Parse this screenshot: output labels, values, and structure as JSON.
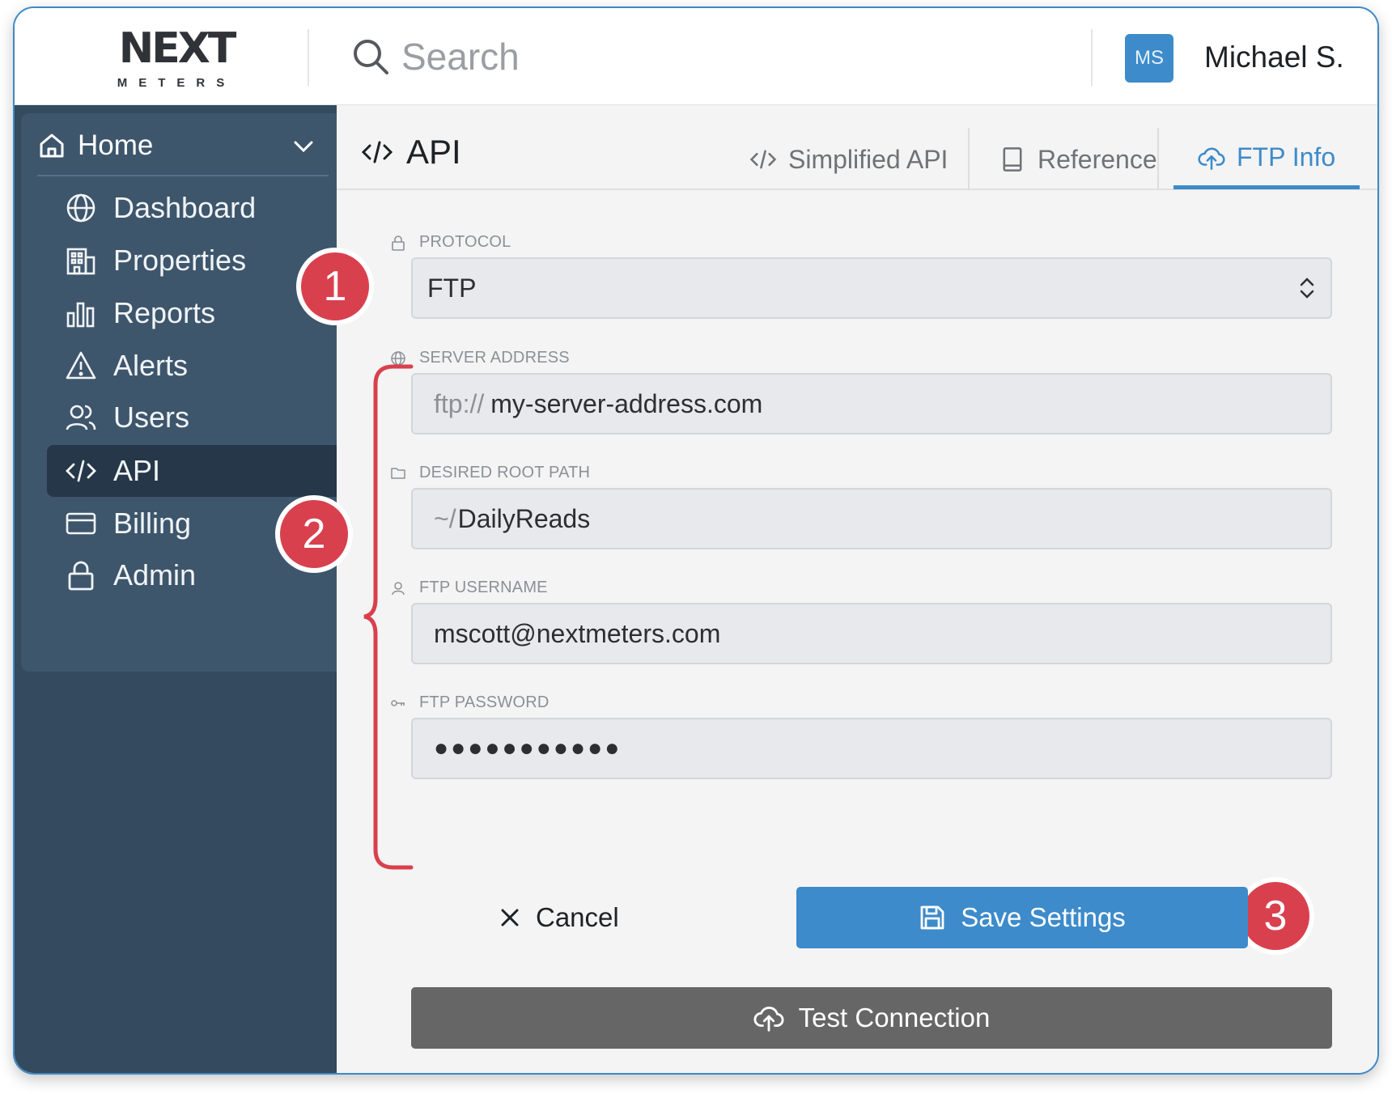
{
  "header": {
    "logo_text": "NEXT",
    "logo_subtext": "METERS",
    "search_placeholder": "Search",
    "user_initials": "MS",
    "user_name": "Michael S."
  },
  "sidebar": {
    "home_label": "Home",
    "items": [
      {
        "label": "Dashboard",
        "icon": "globe-icon"
      },
      {
        "label": "Properties",
        "icon": "building-icon"
      },
      {
        "label": "Reports",
        "icon": "bar-chart-icon"
      },
      {
        "label": "Alerts",
        "icon": "warning-icon"
      },
      {
        "label": "Users",
        "icon": "users-icon"
      },
      {
        "label": "API",
        "icon": "code-icon",
        "active": true
      },
      {
        "label": "Billing",
        "icon": "credit-card-icon"
      },
      {
        "label": "Admin",
        "icon": "lock-icon"
      }
    ]
  },
  "page": {
    "title": "API",
    "tabs": [
      {
        "label": "Simplified API",
        "icon": "code-icon"
      },
      {
        "label": "Reference",
        "icon": "book-icon"
      },
      {
        "label": "FTP Info",
        "icon": "cloud-upload-icon",
        "active": true
      }
    ]
  },
  "form": {
    "protocol": {
      "label": "PROTOCOL",
      "value": "FTP"
    },
    "server_address": {
      "label": "SERVER ADDRESS",
      "prefix": "ftp://",
      "value": "my-server-address.com"
    },
    "root_path": {
      "label": "DESIRED ROOT PATH",
      "prefix": "~/",
      "value": "DailyReads"
    },
    "username": {
      "label": "FTP USERNAME",
      "value": "mscott@nextmeters.com"
    },
    "password": {
      "label": "FTP PASSWORD",
      "value": "●●●●●●●●●●●"
    }
  },
  "actions": {
    "cancel_label": "Cancel",
    "save_label": "Save Settings",
    "test_label": "Test Connection"
  },
  "annotations": {
    "badge_1": "1",
    "badge_2": "2",
    "badge_3": "3"
  },
  "colors": {
    "accent": "#3d8bca",
    "sidebar": "#334a5f",
    "badge": "#d9404e",
    "test_button": "#666666"
  }
}
